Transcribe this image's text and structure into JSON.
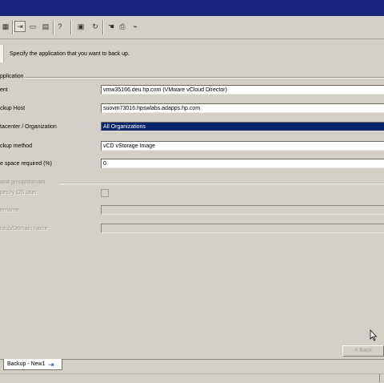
{
  "instruction": "Specify the application that you want to back up.",
  "group_application": "pplication",
  "fields": {
    "client": {
      "label": "ent",
      "value": "vmw35166.deu.hp.com (VMware vCloud Director)"
    },
    "backup_host": {
      "label": "ckup Host",
      "value": "suovm73016.hpswlabs.adapps.hp.com"
    },
    "datacenter": {
      "label": "tacenter / Organization",
      "value": "All Organizations"
    },
    "backup_method": {
      "label": "ckup method",
      "value": "vCD vStorage Image"
    },
    "free_space": {
      "label": "e space required (%)",
      "value": "0"
    }
  },
  "group_user": "and group/domain",
  "user_fields": {
    "specify_os_user": "pecify OS user",
    "username": "ername",
    "group_domain": "roup/Domain name"
  },
  "buttons": {
    "back": "< Back"
  },
  "tab": {
    "label": "Backup - New1"
  },
  "icons": {
    "toolbar": [
      "grid-icon",
      "pin-icon",
      "window-icon",
      "calendar-icon",
      "help-icon",
      "report-icon",
      "refresh-icon",
      "hand-icon",
      "print-icon",
      "disconnect-icon"
    ]
  }
}
